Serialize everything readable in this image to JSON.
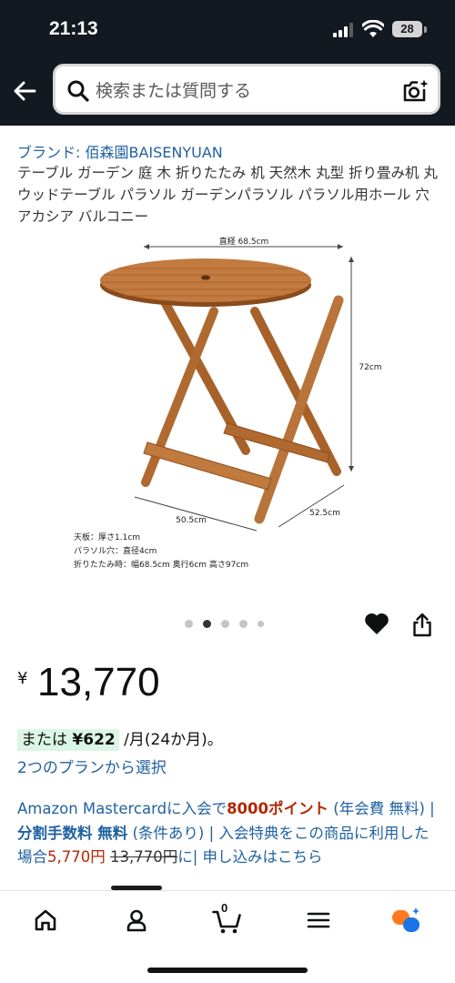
{
  "status_bar": {
    "time": "21:13",
    "battery": "28"
  },
  "search": {
    "placeholder": "検索または質問する"
  },
  "product": {
    "brand": "ブランド: 佰森園BAISENYUAN",
    "title": "テーブル ガーデン 庭 木 折りたたみ 机 天然木 丸型 折り畳み机 丸 ウッドテーブル パラソル ガーデンパラソル パラソル用ホール 穴 アカシア バルコニー",
    "image_labels": {
      "diameter": "直経 68.5cm",
      "height": "72cm",
      "width": "50.5cm",
      "depth": "52.5cm",
      "spec_1": "天板：厚さ1.1cm",
      "spec_2": "パラソル穴：直径4cm",
      "spec_3": "折りたたみ時：幅68.5cm 奥行6cm 高さ97cm"
    },
    "carousel": {
      "count": 5,
      "active_index": 1
    },
    "currency_symbol": "¥",
    "price": "13,770",
    "installment": {
      "prefix": "または",
      "amount": "¥622",
      "suffix": "/月(24か月)。"
    },
    "plans_link": "2つのプランから選択"
  },
  "promo": {
    "part1": "Amazon Mastercardに入会で",
    "points": "8000ポイント",
    "part2": " (年会費 無料) | ",
    "fee_label": "分割手数料 無料",
    "part3": " (条件あり) | 入会特典をこの商品に利用した場合",
    "discounted_price": "5,770円",
    "space": " ",
    "original_price": "13,770円",
    "part4": "に| 申し込みはこちら"
  },
  "nav": {
    "cart_count": "0",
    "items": [
      "home-icon",
      "account-icon",
      "cart-icon",
      "menu-icon",
      "rufus-icon"
    ]
  },
  "colors": {
    "header_bg": "#131921",
    "link": "#2162a1",
    "price_red": "#b12704",
    "installment_bg": "#dbf6e6",
    "rufus_orange": "#ff7a1a",
    "rufus_blue": "#1a73e8"
  }
}
